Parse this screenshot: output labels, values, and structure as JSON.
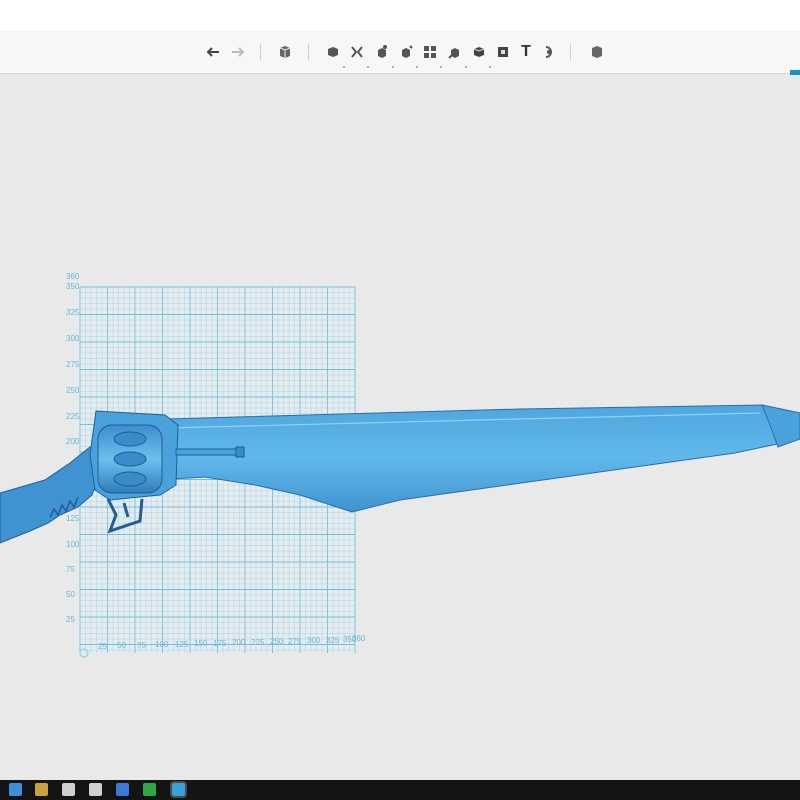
{
  "colors": {
    "accent": "#1a8fc9",
    "grid_line": "#8fd3ea",
    "grid_major": "#6fc3e2",
    "grid_label": "#63bbdc",
    "model_fill": "#5aaee3",
    "model_dark": "#2f7fbe",
    "model_edge": "#1f5f95"
  },
  "toolbar": {
    "undo_icon": "undo-arrow-icon",
    "redo_icon": "redo-arrow-icon",
    "text_tool_label": "T"
  },
  "grid": {
    "y_labels": [
      "360",
      "350",
      "325",
      "300",
      "275",
      "250",
      "225",
      "200",
      "125",
      "100",
      "75",
      "50",
      "25"
    ],
    "x_labels": [
      "25",
      "50",
      "75",
      "100",
      "125",
      "150",
      "175",
      "200",
      "225",
      "250",
      "275",
      "300",
      "325",
      "350",
      "360"
    ]
  },
  "taskbar": {
    "icons": [
      "windows-start-icon",
      "file-explorer-icon",
      "camera-app-icon",
      "paint-app-icon",
      "document-app-icon",
      "media-app-icon",
      "active-3d-app-icon"
    ]
  }
}
